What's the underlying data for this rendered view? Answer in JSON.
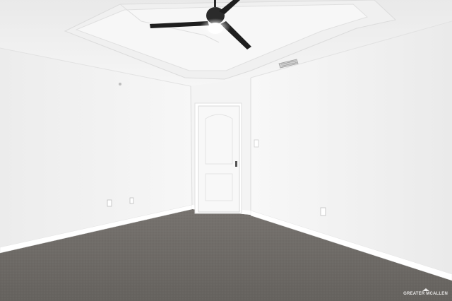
{
  "watermark": {
    "text": "GREATER MCALLEN"
  },
  "colors": {
    "ceiling": "#f2f2f2",
    "wall_left": "#f1f1f1",
    "wall_back": "#f5f5f5",
    "wall_right": "#efefef",
    "baseboard": "#ffffff",
    "carpet": "#6e6b67",
    "door": "#f7f7f7",
    "fan_blade": "#1e1e1e",
    "fan_light": "#ffffff"
  }
}
